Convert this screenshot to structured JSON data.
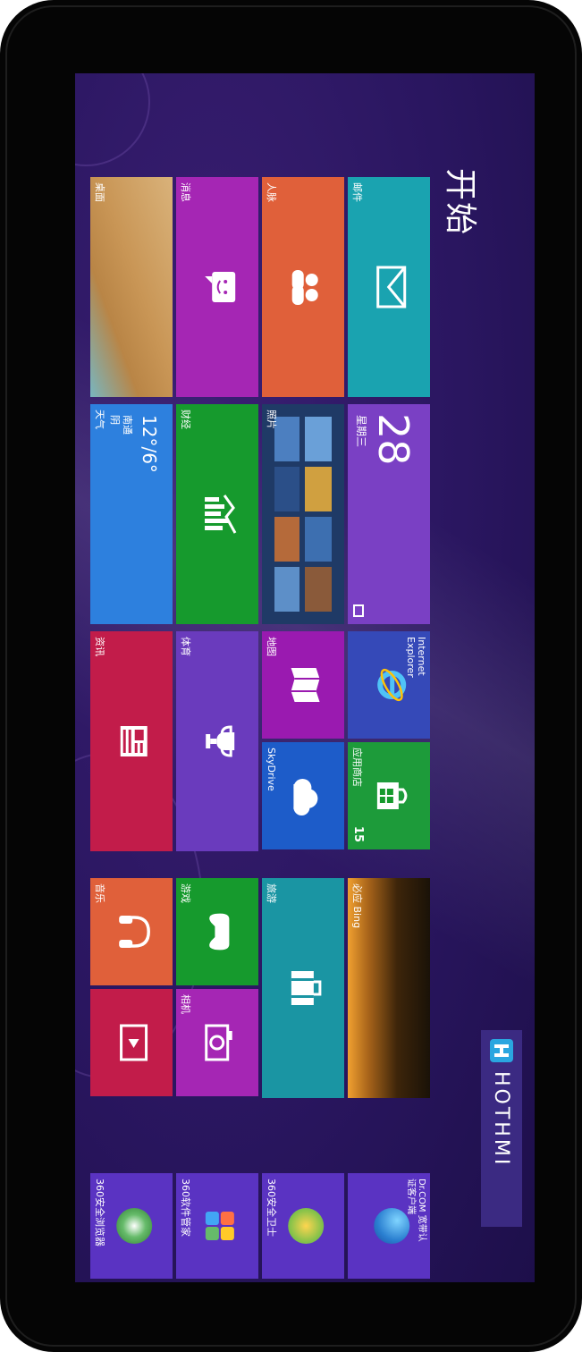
{
  "screen": {
    "title": "开始"
  },
  "tiles": {
    "mail": {
      "label": "邮件"
    },
    "calendar": {
      "date": "28",
      "weekday": "星期三"
    },
    "ie": {
      "label": "Internet Explorer"
    },
    "store": {
      "label": "应用商店",
      "badge": "15"
    },
    "people": {
      "label": "人脉"
    },
    "photos": {
      "label": "照片"
    },
    "maps": {
      "label": "地图"
    },
    "skydrive": {
      "label": "SkyDrive"
    },
    "messaging": {
      "label": "消息"
    },
    "finance": {
      "label": "财经"
    },
    "sports": {
      "label": "体育"
    },
    "desktop": {
      "label": "桌面"
    },
    "weather": {
      "label": "天气",
      "temp": "12°/6°",
      "line1": "南通",
      "line2": "阴"
    },
    "news": {
      "label": "资讯"
    },
    "bing": {
      "label": "必应 Bing"
    },
    "travel": {
      "label": "旅游"
    },
    "games": {
      "label": "游戏"
    },
    "camera": {
      "label": "相机"
    },
    "music": {
      "label": "音乐"
    },
    "video": {
      "label": ""
    },
    "drcom": {
      "label": "Dr.COM 宽带认证客户端"
    },
    "sec360": {
      "label": "360安全卫士"
    },
    "soft360": {
      "label": "360软件管家"
    },
    "browser360": {
      "label": "360安全浏览器"
    }
  },
  "brand": {
    "text": "HOTHMI"
  },
  "colors": {
    "background": "#2a1660",
    "accent": "#7a40c4"
  }
}
